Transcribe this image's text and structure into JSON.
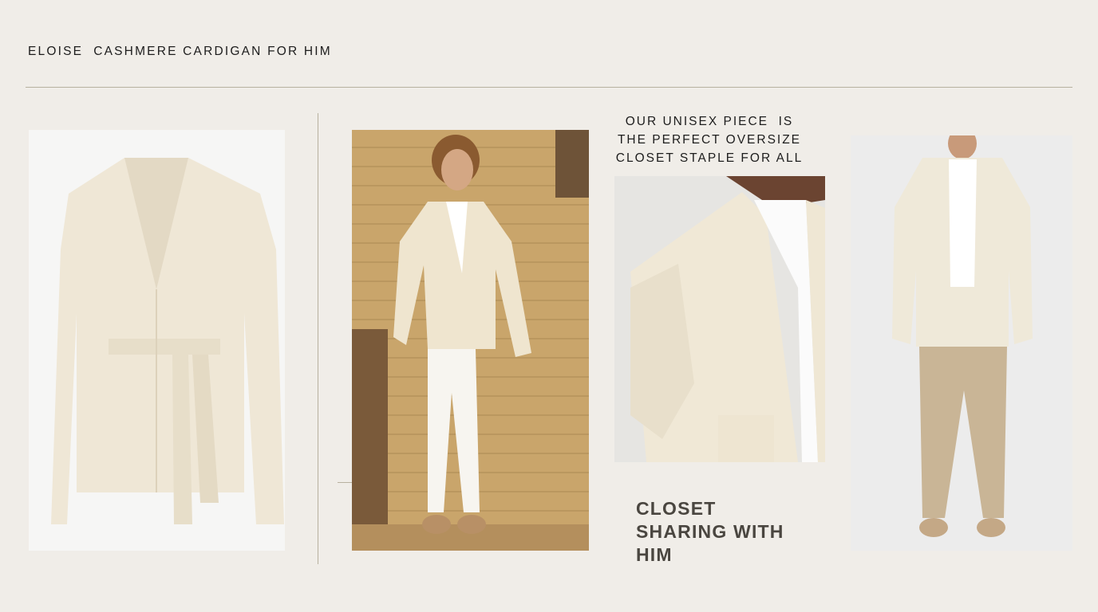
{
  "header": {
    "title": "ELOISE  CASHMERE CARDIGAN FOR HIM"
  },
  "quote": {
    "lines": [
      "OUR UNISEX PIECE  IS",
      "THE PERFECT OVERSIZE",
      "CLOSET STAPLE FOR ALL"
    ]
  },
  "closing": {
    "lines": [
      "CLOSET",
      "SHARING WITH",
      "HIM"
    ]
  },
  "colors": {
    "background": "#f0ede8",
    "rule": "#b7b19f",
    "text": "#1d1d1d",
    "heading": "#4a4640",
    "cardigan": "#efe7d6"
  }
}
